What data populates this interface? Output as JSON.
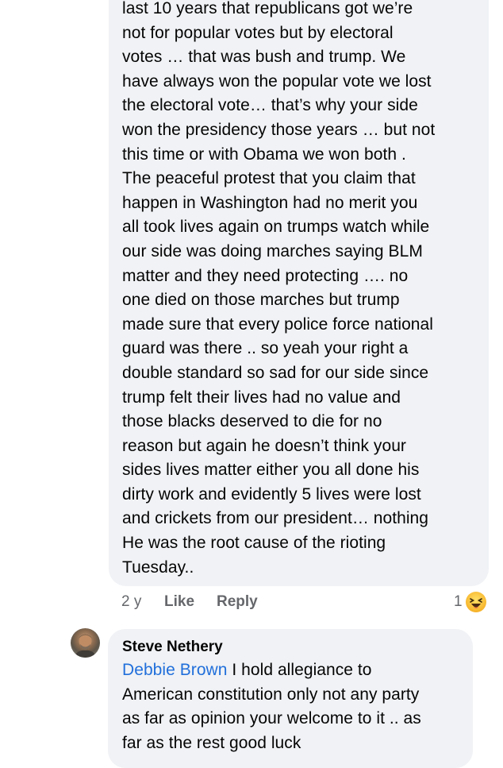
{
  "comment1": {
    "text": "last 10 years that republicans got we’re\nnot for popular votes  but by electoral\nvotes … that was bush and trump. We\nhave always won the popular vote we lost\nthe electoral vote… that’s why your side\nwon the presidency those years … but not\nthis time or with Obama we won both .\nThe peaceful protest that you claim that\nhappen in Washington had no merit you\nall took lives again on trumps watch while\nour side was doing marches saying BLM\nmatter and they need protecting  …. no\none died on those marches but trump\nmade sure that every police force national\nguard was there ..  so yeah your right a\ndouble standard so sad for  our side since\ntrump felt their lives had no value and\nthose blacks deserved to die for no\nreason but again he doesn’t think your\nsides lives matter either you all done his\ndirty work and evidently 5 lives were lost\nand crickets from our president… nothing\nHe was the root cause of the rioting\nTuesday..",
    "time": "2 y",
    "like_label": "Like",
    "reply_label": "Reply",
    "reaction_count": "1",
    "reaction_icon": "laughing-emoji-icon"
  },
  "comment2": {
    "author": "Steve Nethery",
    "mention": "Debbie Brown",
    "text_first_line": " I hold allegiance to",
    "text_rest": "American constitution only not any party\nas far as opinion your welcome to it .. as\nfar as the rest good luck",
    "avatar_icon": "user-avatar"
  },
  "colors": {
    "bubble": "#f0f2f5",
    "meta": "#65676b",
    "link": "#216fdb",
    "text": "#050505"
  }
}
